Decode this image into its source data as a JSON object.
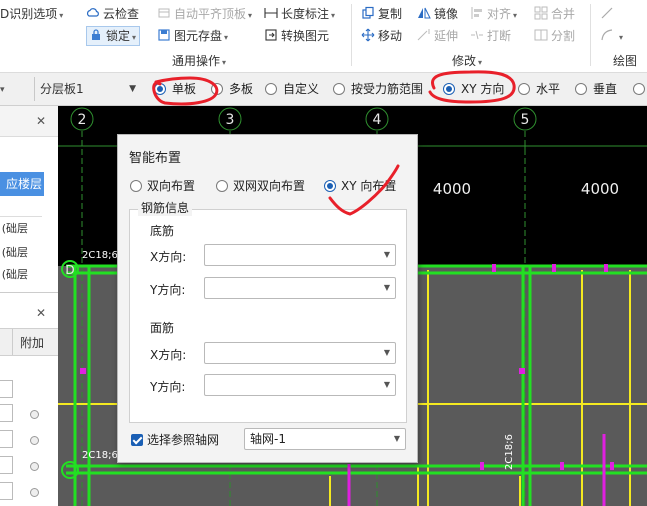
{
  "ribbon": {
    "col1": [
      "D识别选项",
      "云检查",
      "锁定",
      "自动平齐顶板",
      "图元存盘",
      "长度标注",
      "转换图元"
    ],
    "general_ops_label": "通用操作",
    "modify": {
      "copy": "复制",
      "move": "移动",
      "mirror": "镜像",
      "extend": "延伸",
      "align": "对齐",
      "break": "打断",
      "merge": "合并",
      "split": "分割",
      "label": "修改"
    },
    "draw_label": "绘图"
  },
  "optbar": {
    "layer": "分层板1",
    "radios": [
      "单板",
      "多板",
      "自定义",
      "按受力筋范围",
      "XY 方向",
      "水平",
      "垂直"
    ],
    "selected_radio": "XY 方向"
  },
  "leftpanel": {
    "layer_button": "应楼层",
    "items": [
      "础层)",
      "础层)",
      "础层)"
    ],
    "extra_header": "附加"
  },
  "canvas": {
    "axes": [
      "2",
      "3",
      "4",
      "5"
    ],
    "dims": [
      "4000",
      "4000"
    ],
    "marks": [
      "2C18;6",
      "2C18;6",
      "2C18;6"
    ],
    "node_label": "D"
  },
  "dialog": {
    "title": "智能布置",
    "mode_radios": [
      "双向布置",
      "双网双向布置",
      "XY 向布置"
    ],
    "selected_mode": "XY 向布置",
    "rebar_group": "钢筋信息",
    "bottom_label": "底筋",
    "top_label": "面筋",
    "x_label": "X方向:",
    "y_label": "Y方向:",
    "bottom_x": "",
    "bottom_y": "",
    "top_x": "",
    "top_y": "",
    "grid_check_label": "选择参照轴网",
    "grid_checked": true,
    "grid_value": "轴网-1"
  },
  "colors": {
    "canvas_bg": "#5a5a5a",
    "outer_bg": "#000000",
    "beam_green": "#22e022",
    "wall_yellow": "#f5ea20",
    "rebar_magenta": "#e020e0",
    "axis_line": "#2f8f2f",
    "annotation_red": "#e8202a"
  }
}
